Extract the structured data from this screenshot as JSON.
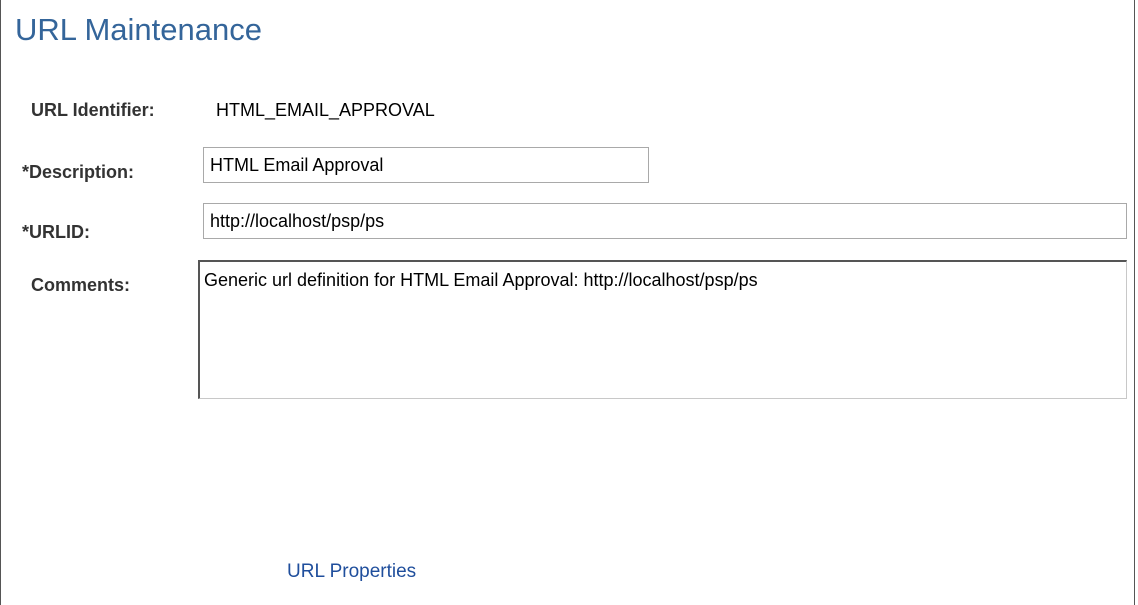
{
  "page": {
    "title": "URL Maintenance"
  },
  "form": {
    "url_identifier": {
      "label": "URL Identifier:",
      "value": "HTML_EMAIL_APPROVAL"
    },
    "description": {
      "label": "*Description:",
      "value": "HTML Email Approval"
    },
    "urlid": {
      "label": "*URLID:",
      "value": "http://localhost/psp/ps"
    },
    "comments": {
      "label": "Comments:",
      "value": "Generic url definition for HTML Email Approval: http://localhost/psp/ps"
    }
  },
  "links": {
    "url_properties": "URL Properties"
  },
  "colors": {
    "title": "#34659a",
    "link": "#1f4e9c",
    "label": "#333333"
  }
}
